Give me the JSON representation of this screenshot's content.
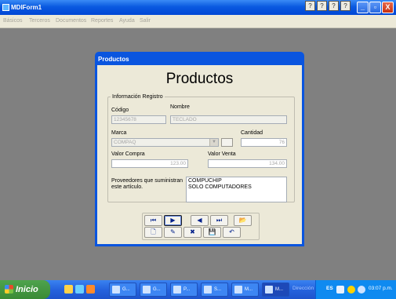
{
  "window": {
    "title": "MDIForm1",
    "top_icons": [
      "?",
      "?",
      "?",
      "?"
    ],
    "minimize": "_",
    "restore": "▫",
    "close": "X"
  },
  "menu": [
    "Básicos",
    "Terceros",
    "Documentos",
    "Reportes",
    "Ayuda",
    "Salir"
  ],
  "dialog": {
    "title": "Productos",
    "heading": "Productos",
    "group_label": "Información Registro",
    "fields": {
      "codigo_label": "Código",
      "codigo_value": "12345678",
      "nombre_label": "Nombre",
      "nombre_value": "TECLADO",
      "marca_label": "Marca",
      "marca_value": "COMPAQ",
      "cantidad_label": "Cantidad",
      "cantidad_value": "76",
      "valor_compra_label": "Valor Compra",
      "valor_compra_value": "123.00",
      "valor_venta_label": "Valor Venta",
      "valor_venta_value": "134.00",
      "proveedores_label": "Proveedores que suministran este artículo.",
      "proveedores": [
        "COMPUCHIP",
        "SOLO COMPUTADORES"
      ]
    },
    "nav_buttons_row1": [
      "⏮",
      "▶",
      "◀",
      "⏭",
      "📂"
    ],
    "nav_buttons_row2": [
      "🗋",
      "✎",
      "✖",
      "💾",
      "↶"
    ]
  },
  "taskbar": {
    "start_label": "Inicio",
    "tasks": [
      "G...",
      "G...",
      "P...",
      "S...",
      "M...",
      "M..."
    ],
    "tray_label": "Dirección",
    "language": "ES",
    "clock": "03:07 p.m."
  }
}
